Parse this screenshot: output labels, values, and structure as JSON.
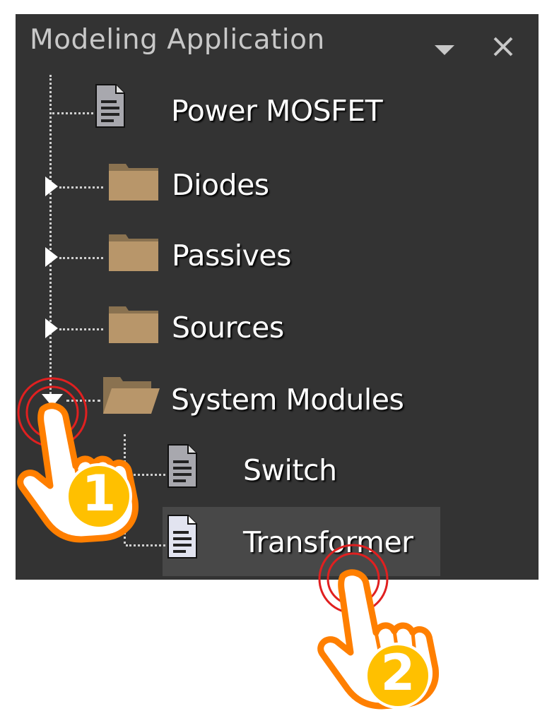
{
  "panel": {
    "title": "Modeling Application",
    "menu_icon": "dropdown-arrow-icon",
    "close_icon": "close-icon",
    "background": "#333333",
    "selected_background": "#484848"
  },
  "tree": {
    "items": [
      {
        "label": "Power MOSFET",
        "icon": "document-icon",
        "expander": "none"
      },
      {
        "label": "Diodes",
        "icon": "folder-icon",
        "expander": "collapsed"
      },
      {
        "label": "Passives",
        "icon": "folder-icon",
        "expander": "collapsed"
      },
      {
        "label": "Sources",
        "icon": "folder-icon",
        "expander": "collapsed"
      },
      {
        "label": "System Modules",
        "icon": "folder-open-icon",
        "expander": "expanded",
        "children": [
          {
            "label": "Switch",
            "icon": "document-icon"
          },
          {
            "label": "Transformer",
            "icon": "document-icon",
            "selected": true
          }
        ]
      }
    ]
  },
  "annotations": {
    "step1": "1",
    "step2": "2",
    "hand_color": "#ff7f00",
    "badge_color": "#ffc000",
    "ring_color": "#e02020"
  }
}
